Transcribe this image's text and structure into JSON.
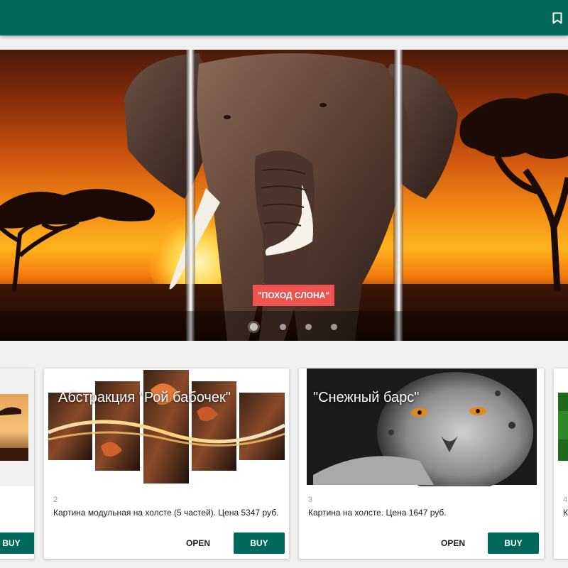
{
  "colors": {
    "app_bar": "#00695c",
    "buy_button": "#00695c",
    "caption_badge": "#ef5350"
  },
  "app_bar": {
    "icon": "bookmark-icon"
  },
  "hero": {
    "caption": "\"ПОХОД СЛОНА\"",
    "slides": 4,
    "active_slide": 1
  },
  "cards": [
    {
      "number": "",
      "title": "",
      "description": "",
      "open_label": "",
      "buy_label": "BUY"
    },
    {
      "number": "2",
      "title": "Абстракция \"Рой бабочек\"",
      "description": "Картина модульная на холсте (5 частей). Цена 5347 руб.",
      "open_label": "OPEN",
      "buy_label": "BUY"
    },
    {
      "number": "3",
      "title": "\"Снежный барс\"",
      "description": "Картина на холсте. Цена 1647 руб.",
      "open_label": "OPEN",
      "buy_label": "BUY"
    },
    {
      "number": "4",
      "title": "",
      "description": "К",
      "open_label": "",
      "buy_label": ""
    }
  ]
}
